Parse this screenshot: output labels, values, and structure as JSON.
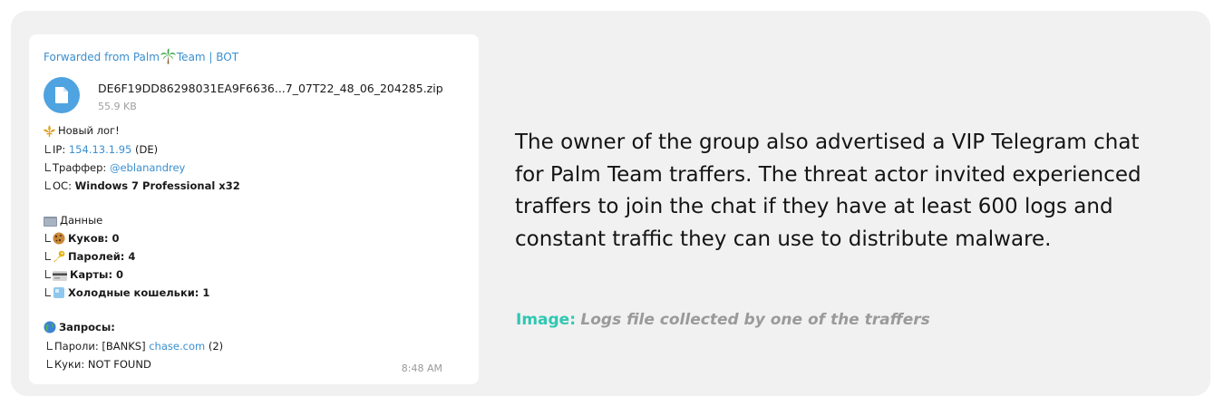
{
  "message": {
    "forwarded_prefix": "Forwarded from Palm",
    "forwarded_suffix": "Team | BOT",
    "file": {
      "name": "DE6F19DD86298031EA9F6636...7_07T22_48_06_204285.zip",
      "size": "55.9 KB"
    },
    "new_log": "Новый лог!",
    "ip_label": "IP:",
    "ip_value": "154.13.1.95",
    "ip_country": "(DE)",
    "traffer_label": "Траффер:",
    "traffer_value": "@eblanandrey",
    "os_label": "ОС:",
    "os_value": "Windows 7 Professional x32",
    "data_title": "Данные",
    "cookies": "Куков: 0",
    "passwords": "Паролей: 4",
    "cards": "Карты: 0",
    "wallets": "Холодные кошельки: 1",
    "queries_title": "Запросы:",
    "q_passwords_label": "Пароли:",
    "q_passwords_banks": "[BANKS]",
    "q_passwords_link": "chase.com",
    "q_passwords_count": "(2)",
    "q_cookies": "Куки:  NOT FOUND",
    "time": "8:48 AM"
  },
  "description": "The owner of the group also advertised a VIP Telegram chat for Palm Team traffers. The threat actor invited experienced traffers to join the chat if they have at least 600 logs and constant traffic they can use to distribute malware.",
  "caption": {
    "label": "Image:",
    "text": "Logs file collected by one of the traffers"
  },
  "colors": {
    "link": "#3a8fd0",
    "accent": "#2fc7b2",
    "panel": "#f1f1f1"
  }
}
